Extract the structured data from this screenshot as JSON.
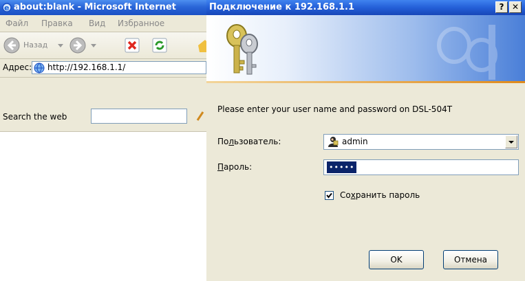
{
  "browser": {
    "title": "about:blank - Microsoft Internet",
    "menu": [
      "Файл",
      "Правка",
      "Вид",
      "Избранное"
    ],
    "back_label": "Назад",
    "address_label": "Адрес:",
    "address_value": "http://192.168.1.1/",
    "search_label": "Search the web"
  },
  "dialog": {
    "title": "Подключение к 192.168.1.1",
    "help_button": "?",
    "close_button": "✕",
    "prompt": "Please enter your user name and password on DSL-504T",
    "user_label_before": "По",
    "user_label_accel": "л",
    "user_label_after": "ьзователь:",
    "username_value": "admin",
    "password_label_accel": "П",
    "password_label_after": "ароль:",
    "password_value": "•••••",
    "save_label_before": "Со",
    "save_label_accel": "х",
    "save_label_after": "ранить пароль",
    "save_checked": true,
    "ok_label": "OK",
    "cancel_label": "Отмена"
  },
  "colors": {
    "titlebar": "#245fd8",
    "dialog_bg": "#ece9d8",
    "selection": "#0b246a"
  }
}
